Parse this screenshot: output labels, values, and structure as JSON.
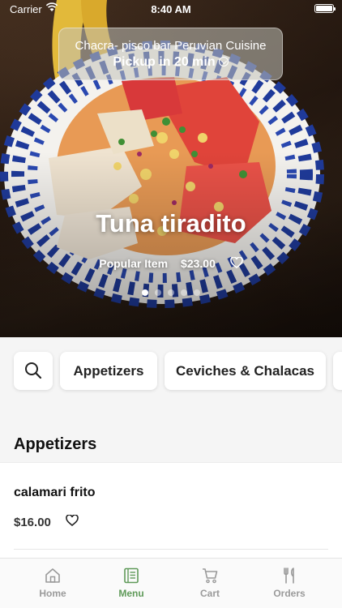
{
  "status_bar": {
    "carrier": "Carrier",
    "time": "8:40 AM",
    "icons": [
      "wifi-icon",
      "battery-icon"
    ]
  },
  "restaurant": {
    "name": "Chacra- pisco bar Peruvian Cuisine",
    "pickup": "Pickup in 20 min",
    "pickup_icon": "chevron-down-circle-icon"
  },
  "featured": {
    "name": "Tuna tiradito",
    "tag": "Popular Item",
    "price": "$23.00",
    "favorite_icon": "heart-icon",
    "carousel_total": 5,
    "carousel_active": 1
  },
  "categories": {
    "search_icon": "search-icon",
    "items": [
      "Appetizers",
      "Ceviches & Chalacas",
      ""
    ]
  },
  "section": {
    "title": "Appetizers",
    "items": [
      {
        "name": "calamari frito",
        "price": "$16.00",
        "favorite_icon": "heart-icon"
      }
    ]
  },
  "tab_bar": {
    "accent": "#5f9a59",
    "inactive": "#9a9a9a",
    "tabs": [
      {
        "label": "Home",
        "icon": "home-icon",
        "active": false
      },
      {
        "label": "Menu",
        "icon": "menu-book-icon",
        "active": true
      },
      {
        "label": "Cart",
        "icon": "cart-icon",
        "active": false
      },
      {
        "label": "Orders",
        "icon": "fork-knife-icon",
        "active": false
      }
    ]
  }
}
